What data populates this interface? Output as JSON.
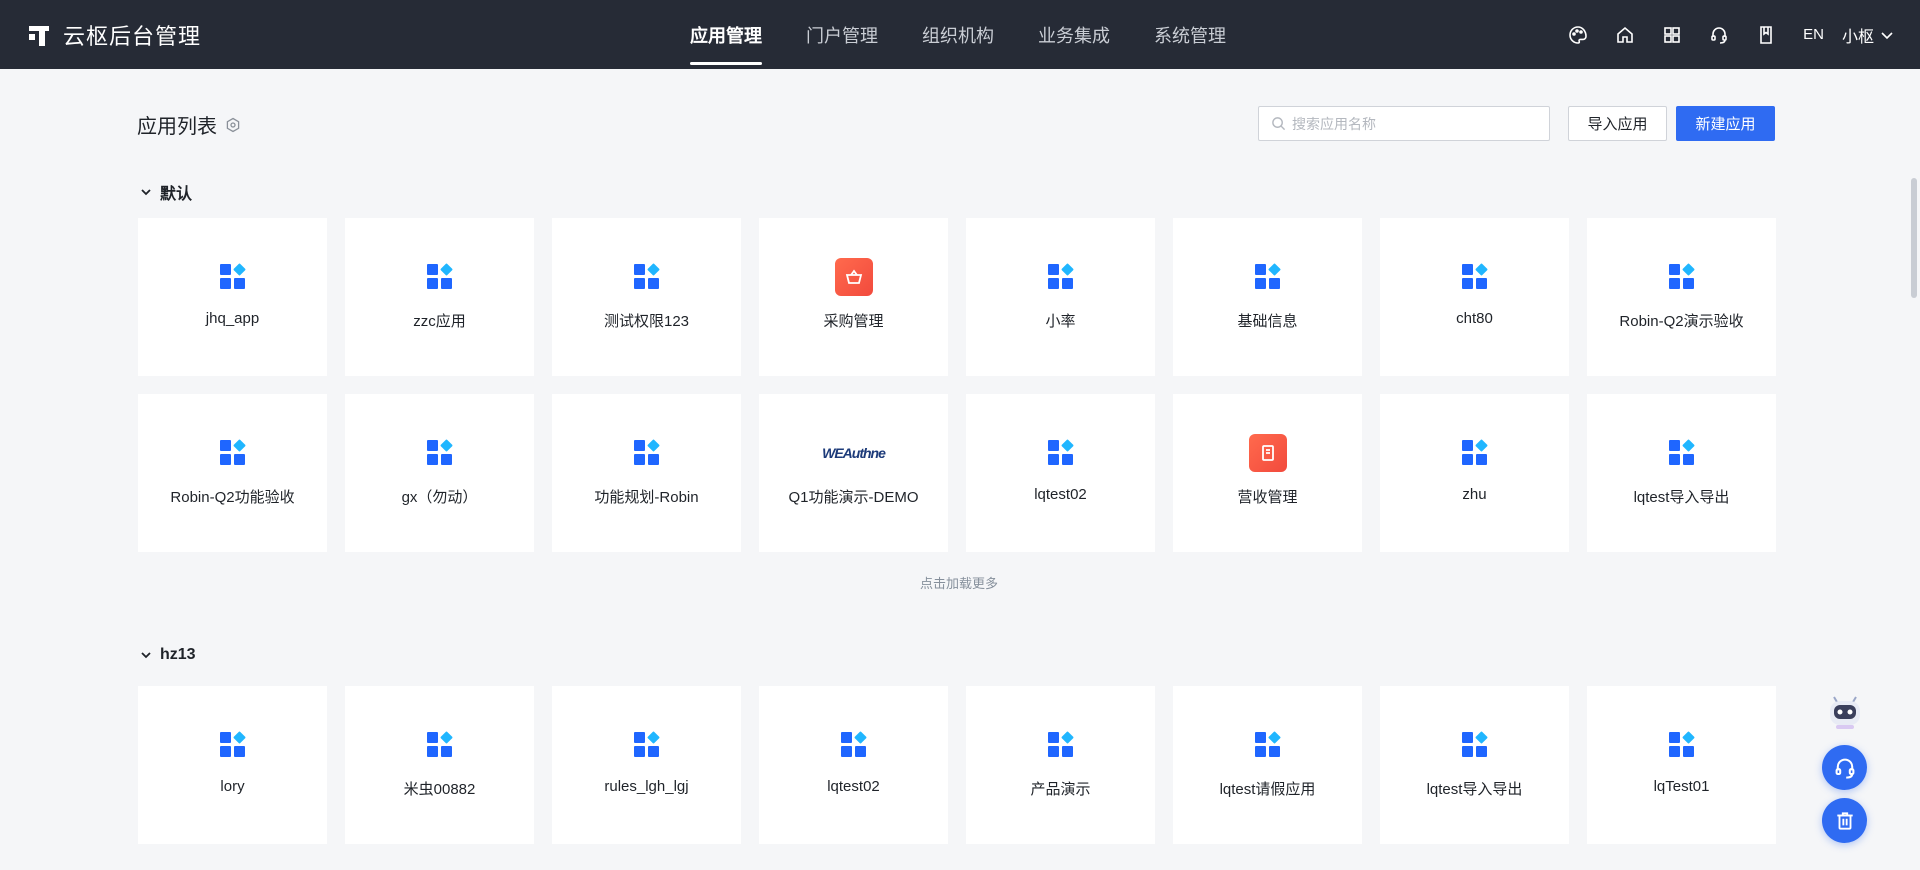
{
  "brand": {
    "title": "云枢后台管理"
  },
  "nav": [
    {
      "label": "应用管理",
      "active": true
    },
    {
      "label": "门户管理",
      "active": false
    },
    {
      "label": "组织机构",
      "active": false
    },
    {
      "label": "业务集成",
      "active": false
    },
    {
      "label": "系统管理",
      "active": false
    }
  ],
  "tools": {
    "icons": [
      "palette-icon",
      "home-icon",
      "grid-icon",
      "headset-icon",
      "book-icon"
    ],
    "lang": "EN",
    "user": "小枢"
  },
  "page": {
    "title": "应用列表",
    "search_placeholder": "搜索应用名称",
    "import_label": "导入应用",
    "new_label": "新建应用"
  },
  "groups": [
    {
      "name": "默认",
      "apps": [
        {
          "label": "jhq_app",
          "icon": "app-grid"
        },
        {
          "label": "zzc应用",
          "icon": "app-grid"
        },
        {
          "label": "测试权限123",
          "icon": "app-grid"
        },
        {
          "label": "采购管理",
          "icon": "basket-red"
        },
        {
          "label": "小率",
          "icon": "app-grid"
        },
        {
          "label": "基础信息",
          "icon": "app-grid"
        },
        {
          "label": "cht80",
          "icon": "app-grid"
        },
        {
          "label": "Robin-Q2演示验收",
          "icon": "app-grid"
        },
        {
          "label": "Robin-Q2功能验收",
          "icon": "app-grid"
        },
        {
          "label": "gx（勿动）",
          "icon": "app-grid"
        },
        {
          "label": "功能规划-Robin",
          "icon": "app-grid"
        },
        {
          "label": "Q1功能演示-DEMO",
          "icon": "image-logo"
        },
        {
          "label": "lqtest02",
          "icon": "app-grid"
        },
        {
          "label": "营收管理",
          "icon": "ledger-red"
        },
        {
          "label": "zhu",
          "icon": "app-grid"
        },
        {
          "label": "lqtest导入导出",
          "icon": "app-grid"
        }
      ],
      "load_more": "点击加载更多"
    },
    {
      "name": "hz13",
      "apps": [
        {
          "label": "lory",
          "icon": "app-grid"
        },
        {
          "label": "米虫00882",
          "icon": "app-grid"
        },
        {
          "label": "rules_lgh_lgj",
          "icon": "app-grid"
        },
        {
          "label": "lqtest02",
          "icon": "app-grid"
        },
        {
          "label": "产品演示",
          "icon": "app-grid"
        },
        {
          "label": "lqtest请假应用",
          "icon": "app-grid"
        },
        {
          "label": "lqtest导入导出",
          "icon": "app-grid"
        },
        {
          "label": "lqTest01",
          "icon": "app-grid"
        }
      ]
    }
  ],
  "logo_text": "WEAuthne",
  "colors": {
    "topbar": "#262b36",
    "primary": "#2f6bf2",
    "app_blue": "#1f66ff",
    "app_cyan": "#20b6ff",
    "app_red": "#f24a3d"
  }
}
